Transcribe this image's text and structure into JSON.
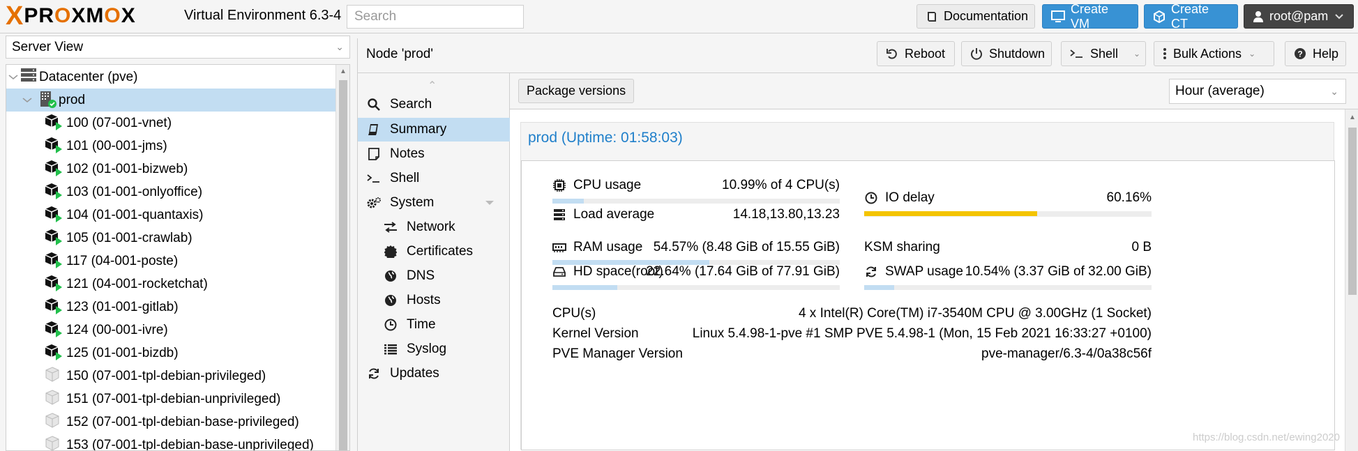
{
  "app": {
    "logo_x": "X",
    "logo_word_a": "PR",
    "logo_word_o1": "O",
    "logo_word_b": "XM",
    "logo_word_o2": "O",
    "logo_word_c": "X",
    "version": "Virtual Environment 6.3-4",
    "search_placeholder": "Search",
    "brand_orange": "#e57000",
    "accent_blue": "#3892d4"
  },
  "topbar": {
    "documentation": "Documentation",
    "create_vm": "Create VM",
    "create_ct": "Create CT",
    "user": "root@pam"
  },
  "left": {
    "view": "Server View",
    "tree": [
      {
        "label": "Datacenter (pve)",
        "level": 0,
        "icon": "datacenter-icon"
      },
      {
        "label": "prod",
        "level": 1,
        "icon": "node-online-icon",
        "selected": true
      },
      {
        "label": "100 (07-001-vnet)",
        "level": 2,
        "icon": "container-running-icon"
      },
      {
        "label": "101 (00-001-jms)",
        "level": 2,
        "icon": "container-running-icon"
      },
      {
        "label": "102 (01-001-bizweb)",
        "level": 2,
        "icon": "container-running-icon"
      },
      {
        "label": "103 (01-001-onlyoffice)",
        "level": 2,
        "icon": "container-running-icon"
      },
      {
        "label": "104 (01-001-quantaxis)",
        "level": 2,
        "icon": "container-running-icon"
      },
      {
        "label": "105 (01-001-crawlab)",
        "level": 2,
        "icon": "container-running-icon"
      },
      {
        "label": "117 (04-001-poste)",
        "level": 2,
        "icon": "container-running-icon"
      },
      {
        "label": "121 (04-001-rocketchat)",
        "level": 2,
        "icon": "container-running-icon"
      },
      {
        "label": "123 (01-001-gitlab)",
        "level": 2,
        "icon": "container-running-icon"
      },
      {
        "label": "124 (00-001-ivre)",
        "level": 2,
        "icon": "container-running-icon"
      },
      {
        "label": "125 (01-001-bizdb)",
        "level": 2,
        "icon": "container-running-icon"
      },
      {
        "label": "150 (07-001-tpl-debian-privileged)",
        "level": 2,
        "icon": "template-icon"
      },
      {
        "label": "151 (07-001-tpl-debian-unprivileged)",
        "level": 2,
        "icon": "template-icon"
      },
      {
        "label": "152 (07-001-tpl-debian-base-privileged)",
        "level": 2,
        "icon": "template-icon"
      },
      {
        "label": "153 (07-001-tpl-debian-base-unprivileged)",
        "level": 2,
        "icon": "template-icon"
      }
    ]
  },
  "node": {
    "title": "Node 'prod'",
    "reboot": "Reboot",
    "shutdown": "Shutdown",
    "shell": "Shell",
    "bulk": "Bulk Actions",
    "help": "Help"
  },
  "menu": [
    {
      "label": "Search",
      "icon": "search-icon"
    },
    {
      "label": "Summary",
      "icon": "book-icon",
      "selected": true
    },
    {
      "label": "Notes",
      "icon": "notes-icon"
    },
    {
      "label": "Shell",
      "icon": "terminal-icon"
    },
    {
      "label": "System",
      "icon": "cogs-icon",
      "expandable": true
    },
    {
      "label": "Network",
      "icon": "exchange-icon",
      "sub": true
    },
    {
      "label": "Certificates",
      "icon": "certificate-icon",
      "sub": true
    },
    {
      "label": "DNS",
      "icon": "globe-icon",
      "sub": true
    },
    {
      "label": "Hosts",
      "icon": "globe-icon",
      "sub": true
    },
    {
      "label": "Time",
      "icon": "clock-icon",
      "sub": true
    },
    {
      "label": "Syslog",
      "icon": "list-icon",
      "sub": true
    },
    {
      "label": "Updates",
      "icon": "refresh-icon"
    }
  ],
  "summary": {
    "package_versions": "Package versions",
    "timeframe": "Hour (average)",
    "panel_title": "prod (Uptime: 01:58:03)",
    "cpu": {
      "label": "CPU usage",
      "value": "10.99% of 4 CPU(s)",
      "fraction": 0.1099
    },
    "load": {
      "label": "Load average",
      "value": "14.18,13.80,13.23"
    },
    "io": {
      "label": "IO delay",
      "value": "60.16%",
      "fraction": 0.6016
    },
    "ram": {
      "label": "RAM usage",
      "value": "54.57% (8.48 GiB of 15.55 GiB)",
      "fraction": 0.5457
    },
    "ksm": {
      "label": "KSM sharing",
      "value": "0 B"
    },
    "hd": {
      "label": "HD space(root)",
      "value": "22.64% (17.64 GiB of 77.91 GiB)",
      "fraction": 0.2264
    },
    "swap": {
      "label": "SWAP usage",
      "value": "10.54% (3.37 GiB of 32.00 GiB)",
      "fraction": 0.1054
    },
    "info": [
      {
        "key": "CPU(s)",
        "value": "4 x Intel(R) Core(TM) i7-3540M CPU @ 3.00GHz (1 Socket)"
      },
      {
        "key": "Kernel Version",
        "value": "Linux 5.4.98-1-pve #1 SMP PVE 5.4.98-1 (Mon, 15 Feb 2021 16:33:27 +0100)"
      },
      {
        "key": "PVE Manager Version",
        "value": "pve-manager/6.3-4/0a38c56f"
      }
    ]
  },
  "watermark": "https://blog.csdn.net/ewing2020"
}
